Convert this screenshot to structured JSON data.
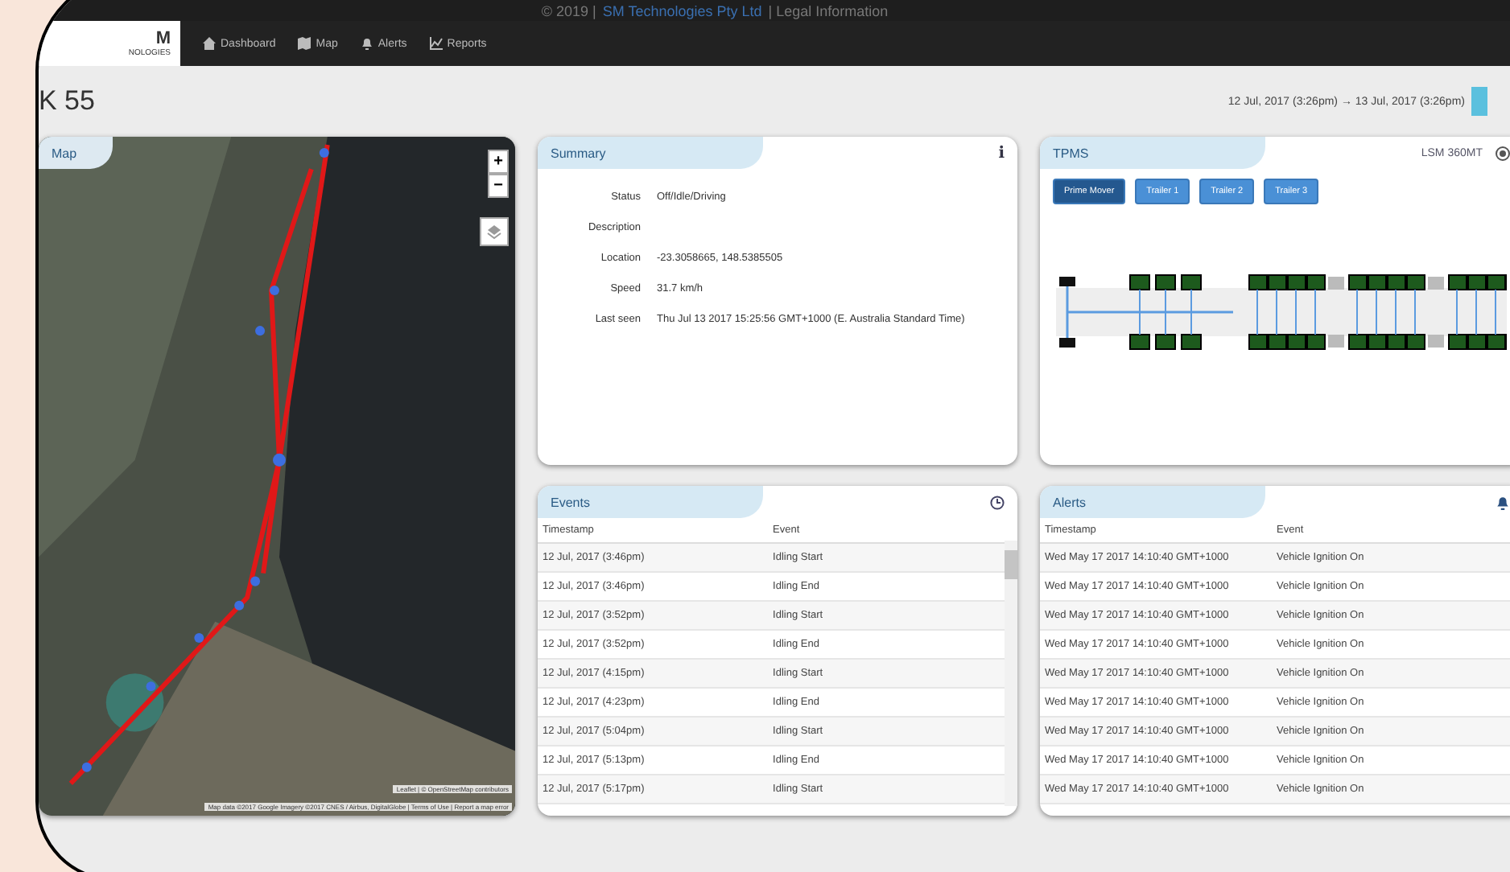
{
  "footer": {
    "copyright": "© 2019 |",
    "company_link": "SM Technologies Pty Ltd",
    "legal_link": "| Legal Information"
  },
  "logo": {
    "mark": "M",
    "caption": "NOLOGIES"
  },
  "nav": [
    {
      "label": "Dashboard"
    },
    {
      "label": "Map"
    },
    {
      "label": "Alerts"
    },
    {
      "label": "Reports"
    }
  ],
  "page_title": "K 55",
  "date_range": "12 Jul, 2017 (3:26pm) → 13 Jul, 2017 (3:26pm)",
  "map": {
    "title": "Map",
    "zoom_in": "+",
    "zoom_out": "−",
    "leaflet_attribution": "Leaflet | © OpenStreetMap contributors",
    "imagery_attribution": "Map data ©2017 Google Imagery ©2017 CNES / Airbus, DigitalGlobe | Terms of Use | Report a map error"
  },
  "summary": {
    "title": "Summary",
    "info": "i",
    "fields": [
      {
        "label": "Status",
        "value": "Off/Idle/Driving"
      },
      {
        "label": "Description"
      },
      {
        "label": "Location",
        "value": "-23.3058665, 148.5385505"
      },
      {
        "label": "Speed",
        "value": "31.7 km/h"
      },
      {
        "label": "Last seen",
        "value": "Thu Jul 13 2017 15:25:56 GMT+1000 (E. Australia Standard Time)"
      }
    ]
  },
  "tpms": {
    "title": "TPMS",
    "model": "LSM 360MT",
    "tabs": [
      {
        "label": "Prime Mover",
        "selected": true
      },
      {
        "label": "Trailer 1",
        "selected": false
      },
      {
        "label": "Trailer 2",
        "selected": false
      },
      {
        "label": "Trailer 3",
        "selected": false
      }
    ]
  },
  "events": {
    "title": "Events",
    "columns": [
      "Timestamp",
      "Event"
    ],
    "rows": [
      [
        "12 Jul, 2017 (3:46pm)",
        "Idling Start"
      ],
      [
        "12 Jul, 2017 (3:46pm)",
        "Idling End"
      ],
      [
        "12 Jul, 2017 (3:52pm)",
        "Idling Start"
      ],
      [
        "12 Jul, 2017 (3:52pm)",
        "Idling End"
      ],
      [
        "12 Jul, 2017 (4:15pm)",
        "Idling Start"
      ],
      [
        "12 Jul, 2017 (4:23pm)",
        "Idling End"
      ],
      [
        "12 Jul, 2017 (5:04pm)",
        "Idling Start"
      ],
      [
        "12 Jul, 2017 (5:13pm)",
        "Idling End"
      ],
      [
        "12 Jul, 2017 (5:17pm)",
        "Idling Start"
      ]
    ]
  },
  "alerts": {
    "title": "Alerts",
    "columns": [
      "Timestamp",
      "Event"
    ],
    "rows": [
      [
        "Wed May 17 2017 14:10:40 GMT+1000",
        "Vehicle Ignition On"
      ],
      [
        "Wed May 17 2017 14:10:40 GMT+1000",
        "Vehicle Ignition On"
      ],
      [
        "Wed May 17 2017 14:10:40 GMT+1000",
        "Vehicle Ignition On"
      ],
      [
        "Wed May 17 2017 14:10:40 GMT+1000",
        "Vehicle Ignition On"
      ],
      [
        "Wed May 17 2017 14:10:40 GMT+1000",
        "Vehicle Ignition On"
      ],
      [
        "Wed May 17 2017 14:10:40 GMT+1000",
        "Vehicle Ignition On"
      ],
      [
        "Wed May 17 2017 14:10:40 GMT+1000",
        "Vehicle Ignition On"
      ],
      [
        "Wed May 17 2017 14:10:40 GMT+1000",
        "Vehicle Ignition On"
      ],
      [
        "Wed May 17 2017 14:10:40 GMT+1000",
        "Vehicle Ignition On"
      ]
    ]
  }
}
